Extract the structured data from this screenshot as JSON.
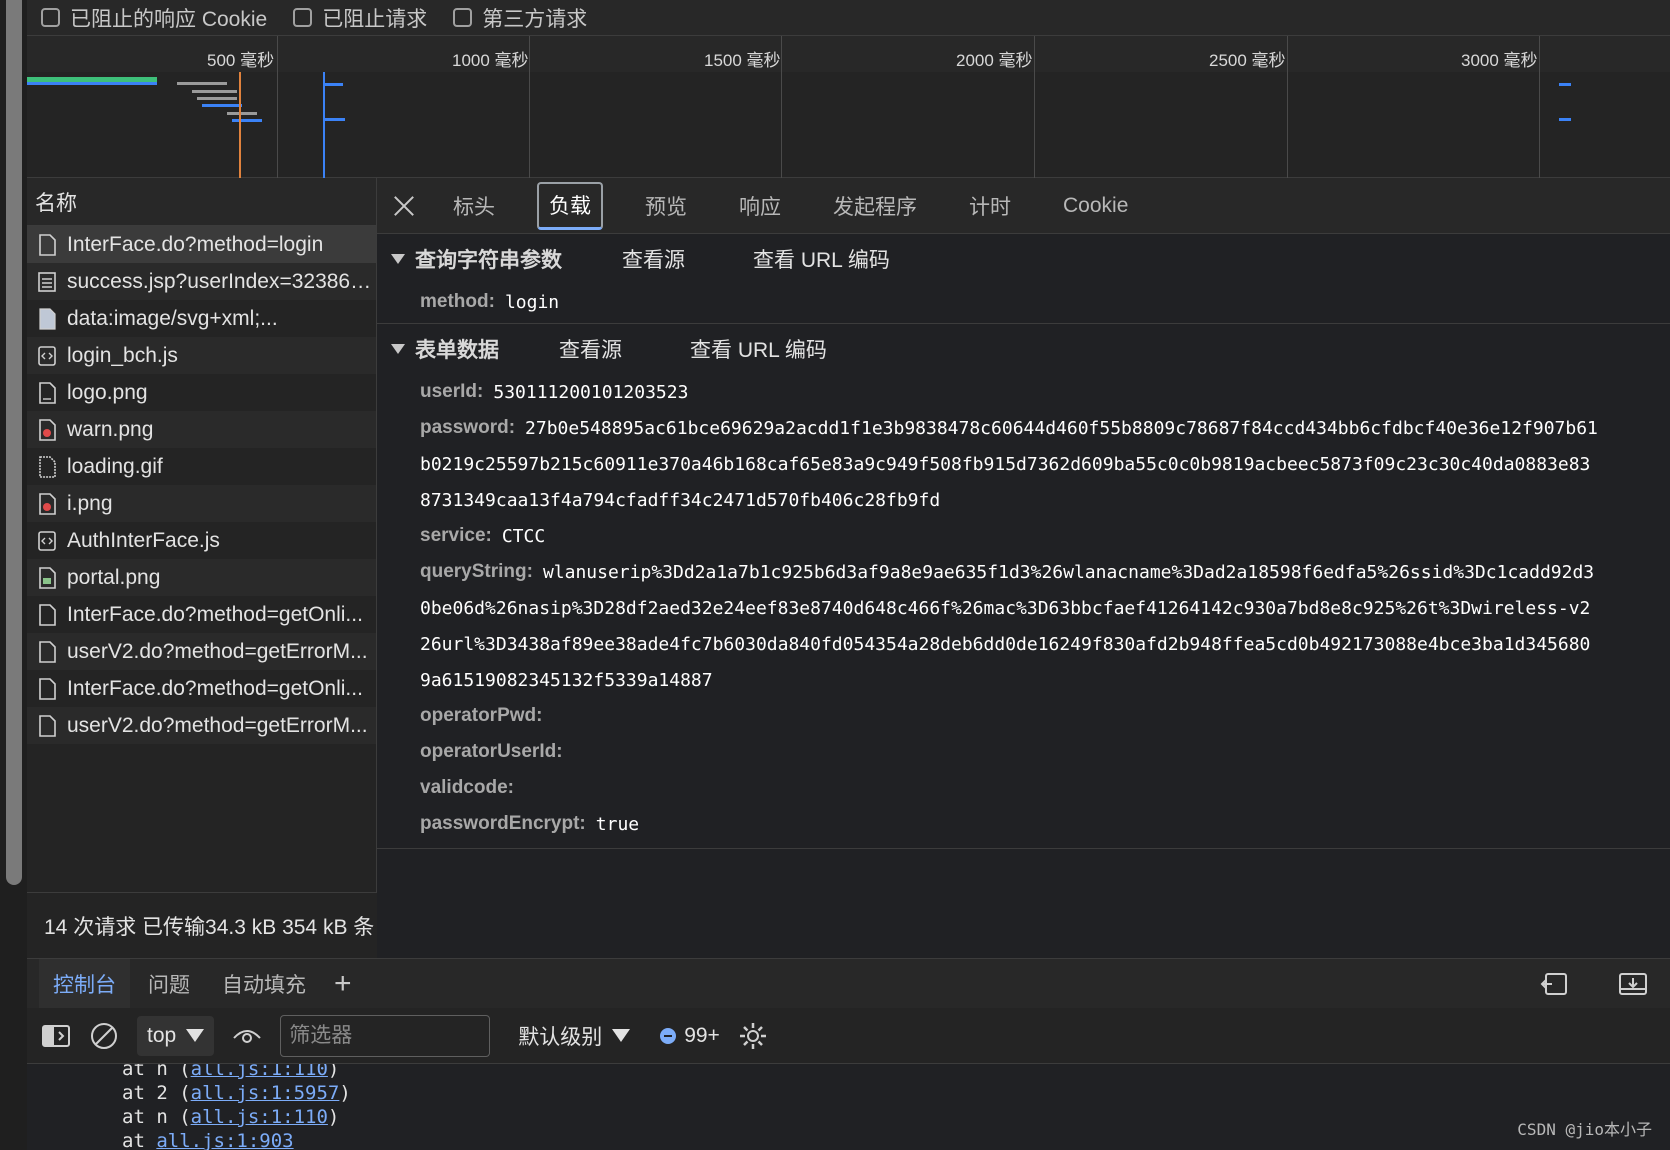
{
  "filters": {
    "blocked_cookies": "已阻止的响应 Cookie",
    "blocked_requests": "已阻止请求",
    "third_party": "第三方请求"
  },
  "timeline": {
    "ticks": [
      "500 毫秒",
      "1000 毫秒",
      "1500 毫秒",
      "2000 毫秒",
      "2500 毫秒",
      "3000 毫秒"
    ]
  },
  "requests": {
    "header": "名称",
    "items": [
      {
        "name": "InterFace.do?method=login",
        "icon": "document-icon"
      },
      {
        "name": "success.jsp?userIndex=323864...",
        "icon": "document-icon"
      },
      {
        "name": "data:image/svg+xml;...",
        "icon": "image-icon"
      },
      {
        "name": "login_bch.js",
        "icon": "script-icon"
      },
      {
        "name": "logo.png",
        "icon": "image-icon"
      },
      {
        "name": "warn.png",
        "icon": "image-icon"
      },
      {
        "name": "loading.gif",
        "icon": "image-icon"
      },
      {
        "name": "i.png",
        "icon": "image-icon"
      },
      {
        "name": "AuthInterFace.js",
        "icon": "script-icon"
      },
      {
        "name": "portal.png",
        "icon": "image-icon"
      },
      {
        "name": "InterFace.do?method=getOnli...",
        "icon": "document-icon"
      },
      {
        "name": "userV2.do?method=getErrorM...",
        "icon": "document-icon"
      },
      {
        "name": "InterFace.do?method=getOnli...",
        "icon": "document-icon"
      },
      {
        "name": "userV2.do?method=getErrorM...",
        "icon": "document-icon"
      }
    ],
    "status": "14 次请求  已传输34.3 kB  354 kB 条"
  },
  "details": {
    "tabs": [
      "标头",
      "负载",
      "预览",
      "响应",
      "发起程序",
      "计时",
      "Cookie"
    ],
    "query": {
      "title": "查询字符串参数",
      "view_source": "查看源",
      "view_url_encoded": "查看 URL 编码",
      "method_key": "method:",
      "method_val": "login"
    },
    "form": {
      "title": "表单数据",
      "view_source": "查看源",
      "view_url_encoded": "查看 URL 编码",
      "userId_key": "userId:",
      "userId_val": "530111200101203523",
      "password_key": "password:",
      "password_val1": "27b0e548895ac61bce69629a2acdd1f1e3b9838478c60644d460f55b8809c78687f84ccd434bb6cfdbcf40e36e12f907b61",
      "password_val2": "b0219c25597b215c60911e370a46b168caf65e83a9c949f508fb915d7362d609ba55c0c0b9819acbeec5873f09c23c30c40da0883e83",
      "password_val3": "8731349caa13f4a794cfadff34c2471d570fb406c28fb9fd",
      "service_key": "service:",
      "service_val": "CTCC",
      "queryString_key": "queryString:",
      "queryString_val1": "wlanuserip%3Dd2a1a7b1c925b6d3af9a8e9ae635f1d3%26wlanacname%3Dad2a18598f6edfa5%26ssid%3Dc1cadd92d3",
      "queryString_val2": "0be06d%26nasip%3D28df2aed32e24eef83e8740d648c466f%26mac%3D63bbcfaef41264142c930a7bd8e8c925%26t%3Dwireless-v2",
      "queryString_val3": "26url%3D3438af89ee38ade4fc7b6030da840fd054354a28deb6dd0de16249f830afd2b948ffea5cd0b492173088e4bce3ba1d345680",
      "queryString_val4": "9a61519082345132f5339a14887",
      "operatorPwd_key": "operatorPwd:",
      "operatorUserId_key": "operatorUserId:",
      "validcode_key": "validcode:",
      "passwordEncrypt_key": "passwordEncrypt:",
      "passwordEncrypt_val": "true"
    }
  },
  "drawer": {
    "tabs": [
      "控制台",
      "问题",
      "自动填充"
    ],
    "context": "top",
    "filter_placeholder": "筛选器",
    "level": "默认级别",
    "issues_count": "99+"
  },
  "console": {
    "line0_prefix": "at n (",
    "line0_link": "all.js:1:110",
    "line0_suffix": ")",
    "line1_prefix": "at 2 (",
    "line1_link": "all.js:1:5957",
    "line1_suffix": ")",
    "line2_prefix": "at n (",
    "line2_link": "all.js:1:110",
    "line2_suffix": ")",
    "line3_prefix": "at ",
    "line3_link": "all.js:1:903"
  },
  "watermark": "CSDN @jio本小子",
  "colors": {
    "accent": "#7cacf8",
    "background": "#202124"
  }
}
